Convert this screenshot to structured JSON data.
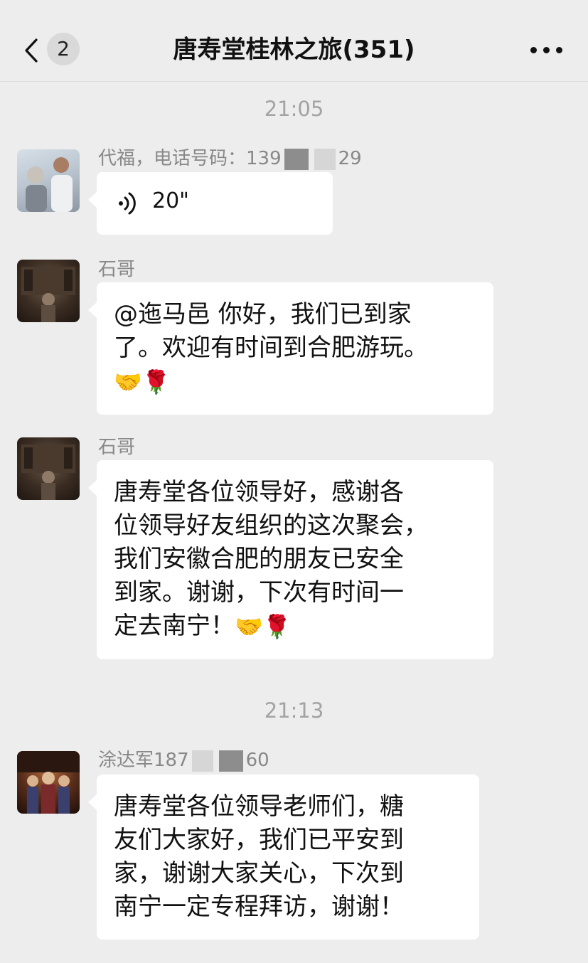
{
  "header": {
    "back_label": "返回",
    "unread_count": "2",
    "title": "唐寿堂桂林之旅(351)",
    "more_label": "更多"
  },
  "timestamps": {
    "t1": "21:05",
    "t2": "21:13"
  },
  "messages": [
    {
      "sender": "代福，电话号码：139",
      "sender_suffix": "29",
      "type": "voice",
      "duration": "20\""
    },
    {
      "sender": "石哥",
      "type": "text",
      "text": "@迤马邑 你好，我们已到家\n了。欢迎有时间到合肥游玩。",
      "emoji": "🤝🌹"
    },
    {
      "sender": "石哥",
      "type": "text",
      "text": "唐寿堂各位领导好，感谢各\n位领导好友组织的这次聚会，\n我们安徽合肥的朋友已安全\n到家。谢谢，下次有时间一\n定去南宁！",
      "emoji": "🤝🌹"
    },
    {
      "sender": "涂达军187",
      "sender_suffix": "60",
      "type": "text",
      "text": "唐寿堂各位领导老师们，糖\n友们大家好，我们已平安到\n家，谢谢大家关心，下次到\n南宁一定专程拜访，谢谢！"
    }
  ],
  "colors": {
    "background": "#ededed",
    "bubble": "#ffffff",
    "meta_text": "#888888"
  }
}
